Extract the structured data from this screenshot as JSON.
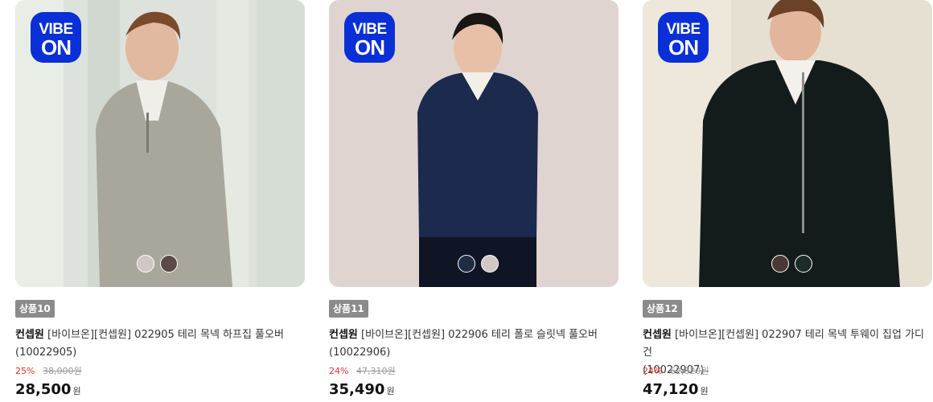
{
  "products": [
    {
      "badge": {
        "line1": "VIBE",
        "line2": "ON",
        "color": "#0a2fd6"
      },
      "tag": "상품10",
      "brand": "컨셉원",
      "title": "[바이브온][컨셉원] 022905 테리 목넥 하프집 풀오버",
      "code": "(10022905)",
      "discount": "25%",
      "original_price": "38,000원",
      "sale_price": "28,500",
      "currency": "원",
      "swatches": [
        {
          "name": "light-gray",
          "color": "#cfc8c4"
        },
        {
          "name": "dark-brown",
          "color": "#5a4a48"
        }
      ]
    },
    {
      "badge": {
        "line1": "VIBE",
        "line2": "ON",
        "color": "#0a2fd6"
      },
      "tag": "상품11",
      "brand": "컨셉원",
      "title": "[바이브온][컨셉원] 022906 테리 폴로 슬릿넥 풀오버",
      "code": "(10022906)",
      "discount": "24%",
      "original_price": "47,310원",
      "sale_price": "35,490",
      "currency": "원",
      "swatches": [
        {
          "name": "navy",
          "color": "#1f2d44"
        },
        {
          "name": "light-gray",
          "color": "#cfc8c4"
        }
      ]
    },
    {
      "badge": {
        "line1": "VIBE",
        "line2": "ON",
        "color": "#0a2fd6"
      },
      "tag": "상품12",
      "brand": "컨셉원",
      "title": "[바이브온][컨셉원] 022907 테리 목넥 투웨이 집업 가디건",
      "code": "(10022907)",
      "discount": "24%",
      "original_price": "62,820원",
      "sale_price": "47,120",
      "currency": "원",
      "swatches": [
        {
          "name": "dark-brown",
          "color": "#4a3836"
        },
        {
          "name": "dark-green",
          "color": "#1d2b2a"
        }
      ]
    }
  ]
}
